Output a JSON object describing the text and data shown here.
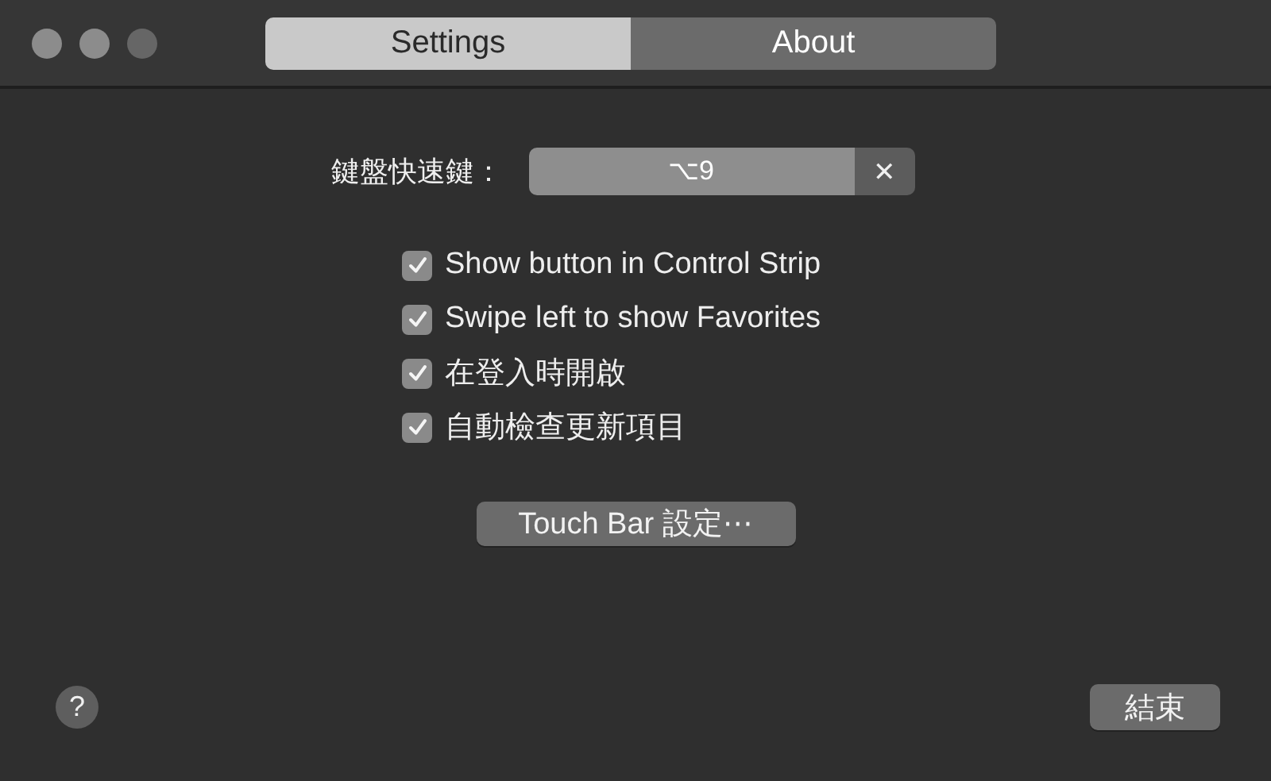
{
  "window": {
    "controls": [
      {
        "kind": "close"
      },
      {
        "kind": "minimize"
      },
      {
        "kind": "zoom"
      }
    ]
  },
  "tabs": [
    {
      "label": "Settings",
      "selected": true
    },
    {
      "label": "About",
      "selected": false
    }
  ],
  "shortcut": {
    "label": "鍵盤快速鍵：",
    "value": "⌥9",
    "clear": "✕"
  },
  "options": [
    {
      "label": "Show button in Control Strip",
      "checked": true
    },
    {
      "label": "Swipe left to show Favorites",
      "checked": true
    },
    {
      "label": "在登入時開啟",
      "checked": true
    },
    {
      "label": "自動檢查更新項目",
      "checked": true
    }
  ],
  "touchbar_button": "Touch Bar 設定⋯",
  "help_button": "?",
  "quit_button": "結束"
}
